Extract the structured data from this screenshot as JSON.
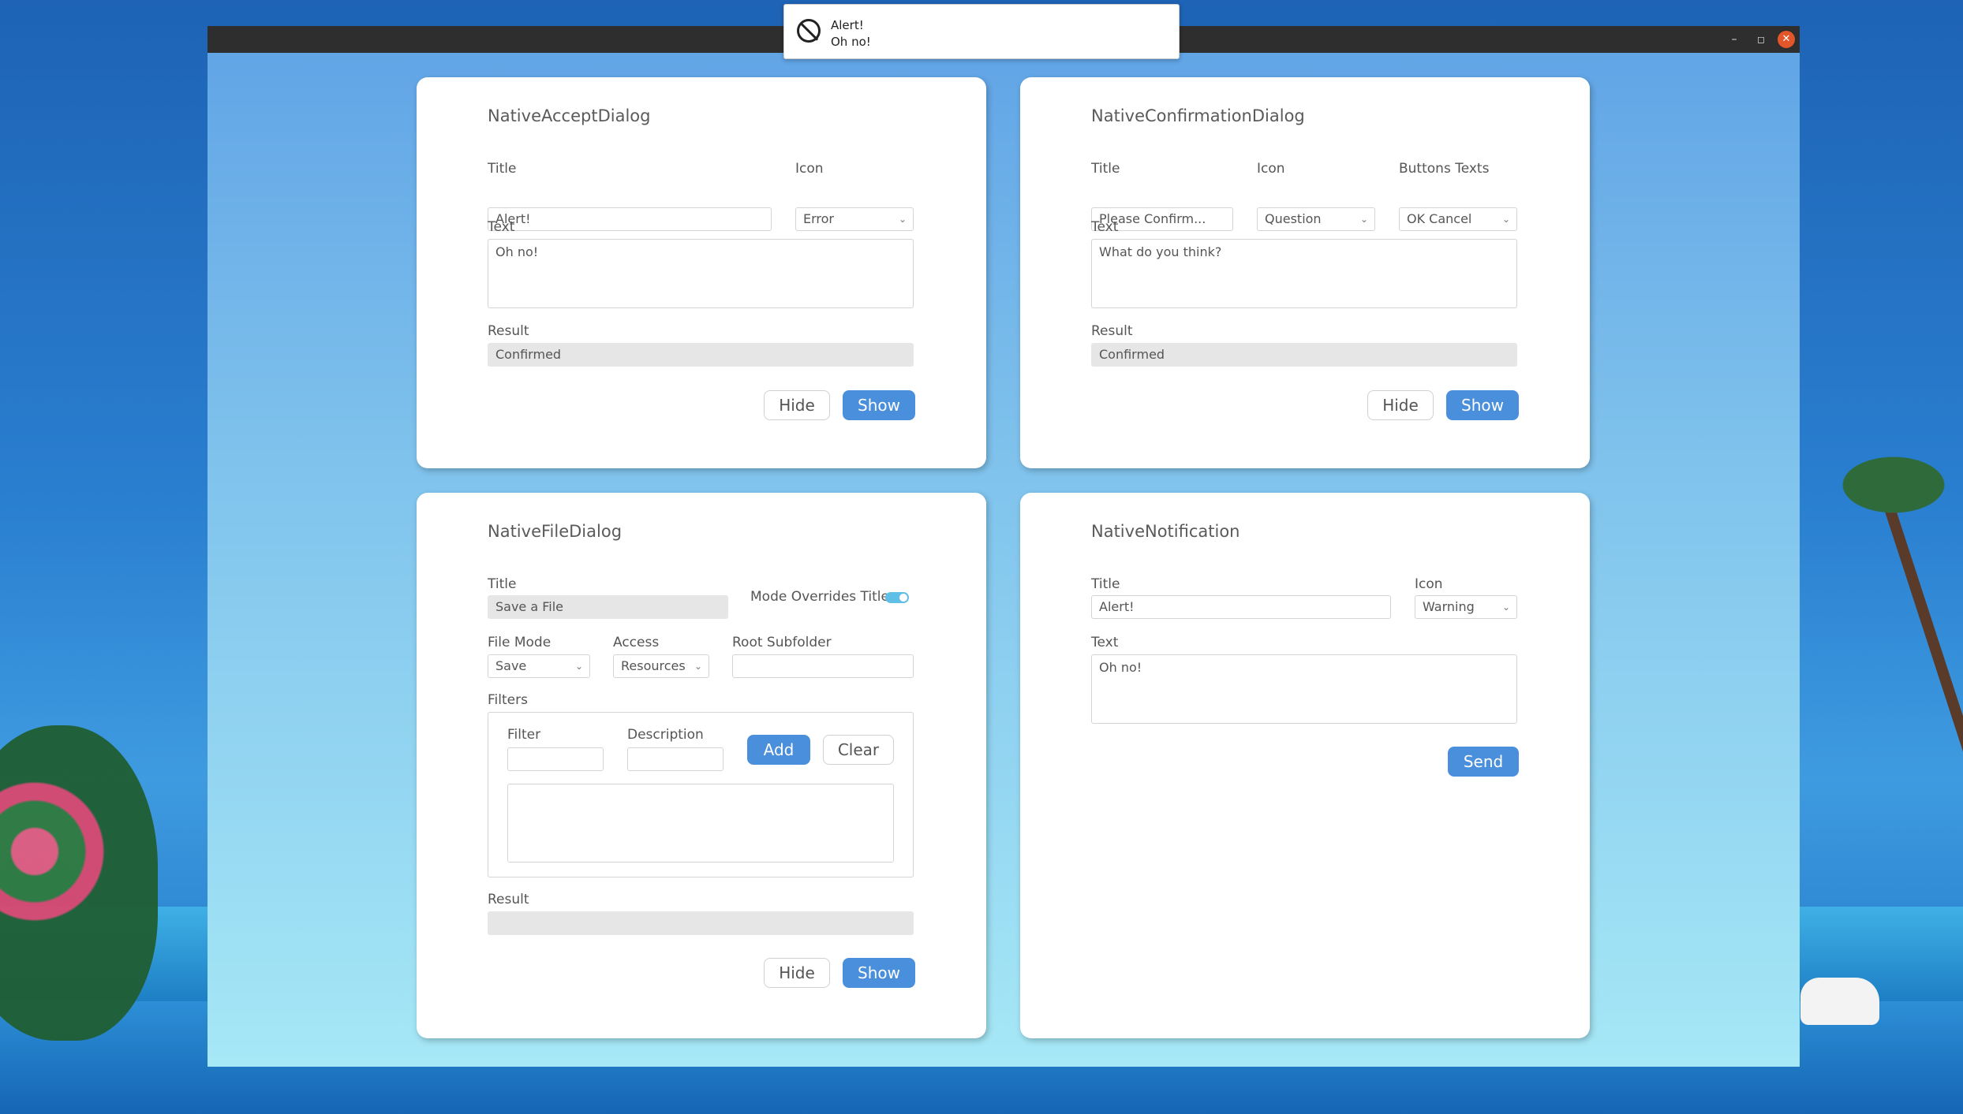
{
  "notification": {
    "title": "Alert!",
    "body": "Oh no!",
    "icon": "forbidden-icon"
  },
  "window": {
    "controls": {
      "minimize": "–",
      "maximize": "◻",
      "close": "✕"
    }
  },
  "accept_dialog": {
    "heading": "NativeAcceptDialog",
    "title_label": "Title",
    "title_value": "Alert!",
    "icon_label": "Icon",
    "icon_value": "Error",
    "text_label": "Text",
    "text_value": "Oh no!",
    "result_label": "Result",
    "result_value": "Confirmed",
    "hide_label": "Hide",
    "show_label": "Show"
  },
  "confirmation_dialog": {
    "heading": "NativeConfirmationDialog",
    "title_label": "Title",
    "title_value": "Please Confirm...",
    "icon_label": "Icon",
    "icon_value": "Question",
    "buttons_label": "Buttons Texts",
    "buttons_value": "OK Cancel",
    "text_label": "Text",
    "text_value": "What do you think?",
    "result_label": "Result",
    "result_value": "Confirmed",
    "hide_label": "Hide",
    "show_label": "Show"
  },
  "file_dialog": {
    "heading": "NativeFileDialog",
    "title_label": "Title",
    "title_value": "Save a File",
    "mode_overrides_label": "Mode Overrides Title",
    "mode_overrides_on": true,
    "file_mode_label": "File Mode",
    "file_mode_value": "Save",
    "access_label": "Access",
    "access_value": "Resources",
    "root_subfolder_label": "Root Subfolder",
    "root_subfolder_value": "",
    "filters_label": "Filters",
    "filter_label": "Filter",
    "filter_value": "",
    "description_label": "Description",
    "description_value": "",
    "add_label": "Add",
    "clear_label": "Clear",
    "filters_list": "",
    "result_label": "Result",
    "result_value": "",
    "hide_label": "Hide",
    "show_label": "Show"
  },
  "notification_panel": {
    "heading": "NativeNotification",
    "title_label": "Title",
    "title_value": "Alert!",
    "icon_label": "Icon",
    "icon_value": "Warning",
    "text_label": "Text",
    "text_value": "Oh no!",
    "send_label": "Send"
  },
  "colors": {
    "accent": "#4a8fdb",
    "toggle": "#5fbfe6",
    "close": "#e2562a"
  }
}
